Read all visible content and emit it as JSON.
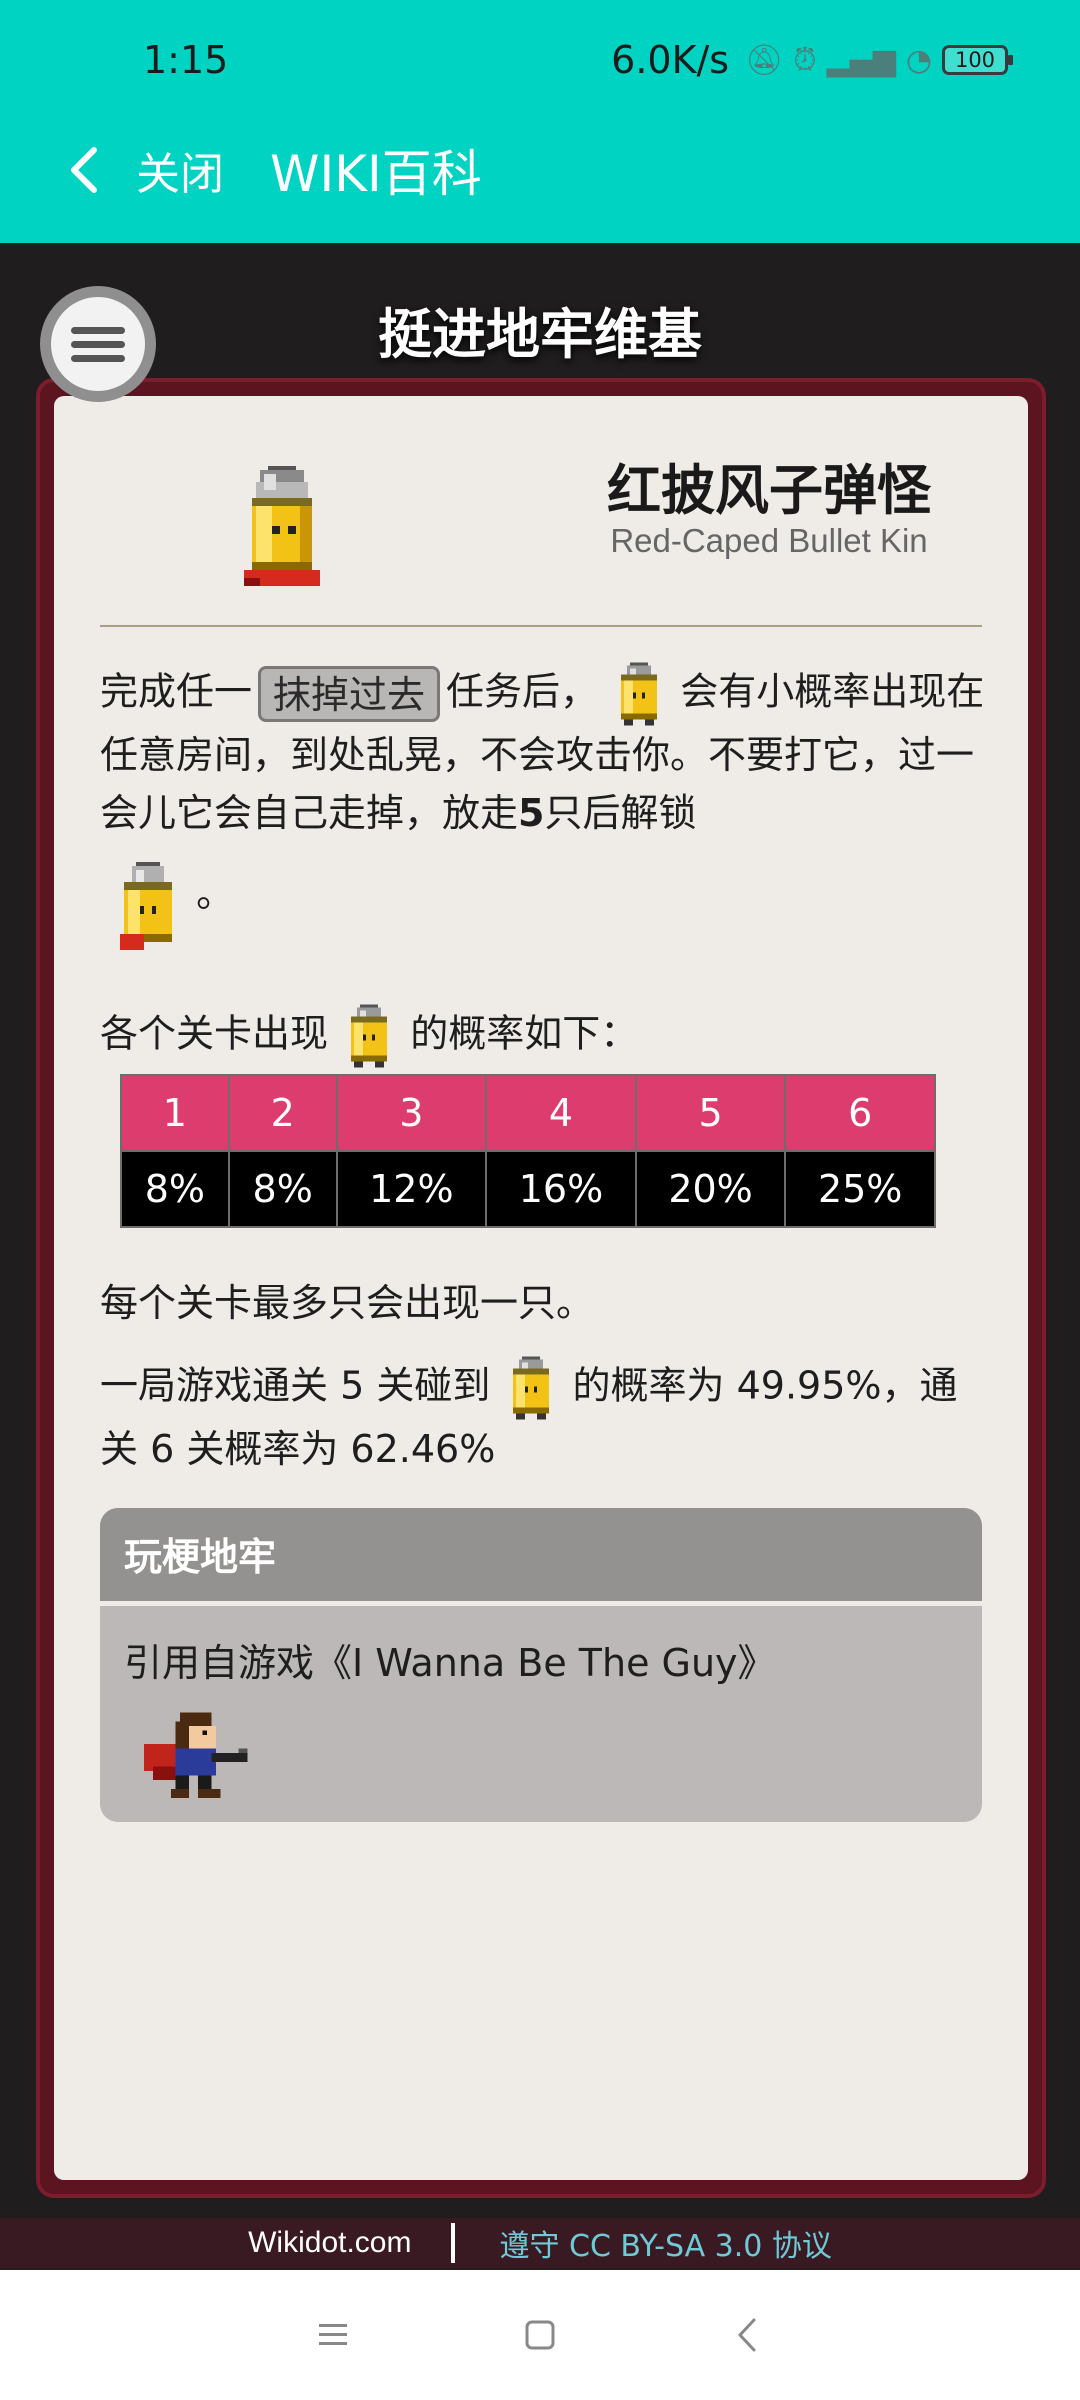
{
  "status_bar": {
    "time": "1:15",
    "net_speed": "6.0K/s",
    "battery": "100"
  },
  "app_bar": {
    "close_label": "关闭",
    "title": "WIKI百科"
  },
  "wiki": {
    "site_title": "挺进地牢维基",
    "page_title_cn": "红披风子弹怪",
    "page_title_en": "Red-Caped Bullet Kin",
    "p1_a": "完成任一",
    "tag_label": "抹掉过去",
    "p1_b": "任务后，",
    "p1_c": "会有小概率出现在任意房间，到处乱晃，不会攻击你。不要打它，过一会儿它会自己走掉，放走",
    "p1_bold": "5",
    "p1_d": "只后解锁",
    "p1_end": "。",
    "p2_a": "各个关卡出现",
    "p2_b": "的概率如下：",
    "table": {
      "headers": [
        "1",
        "2",
        "3",
        "4",
        "5",
        "6"
      ],
      "values": [
        "8%",
        "8%",
        "12%",
        "16%",
        "20%",
        "25%"
      ]
    },
    "p3": "每个关卡最多只会出现一只。",
    "p4_a": "一局游戏通关 5 关碰到",
    "p4_b": "的概率为 49.95%，通关 6 关概率为 62.46%",
    "fun_box": {
      "title": "玩梗地牢",
      "text": "引用自游戏《I Wanna Be The Guy》"
    }
  },
  "footer": {
    "left": "Wikidot.com",
    "right": "遵守 CC BY-SA 3.0 协议"
  },
  "colors": {
    "app_bar": "#00d3c2",
    "frame": "#5b1420",
    "table_header": "#dd3d6e",
    "table_values": "#000000"
  },
  "icons": [
    "back-arrow-icon",
    "menu-icon",
    "bullet-kin-sprite",
    "red-caped-bullet-kin-sprite",
    "the-kid-sprite",
    "nav-menu-icon",
    "nav-home-icon",
    "nav-back-icon"
  ]
}
